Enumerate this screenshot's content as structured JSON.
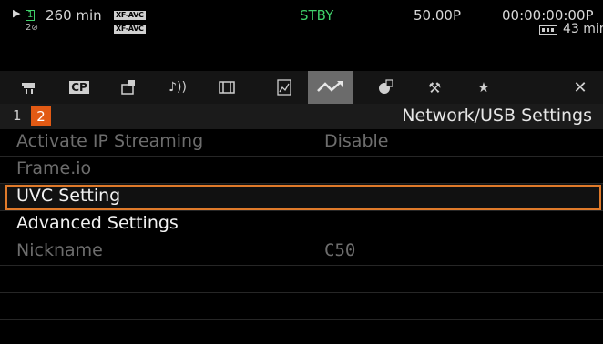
{
  "status": {
    "slot1_number": "1",
    "remaining": "260 min",
    "codec_top": "XF-AVC",
    "codec_bottom": "XF-AVC",
    "slot2_label": "2",
    "mode": "STBY",
    "frame_rate": "50.00P",
    "timecode": "00:00:00:00",
    "timecode_suffix": "P",
    "battery": "43 min"
  },
  "tabs": [
    {
      "icon": "camera-icon"
    },
    {
      "icon": "cp-icon",
      "label": "CP"
    },
    {
      "icon": "custom-picture-icon"
    },
    {
      "icon": "audio-icon"
    },
    {
      "icon": "recording-media-icon"
    },
    {
      "icon": "assist-functions-icon"
    },
    {
      "icon": "network-icon",
      "active": true
    },
    {
      "icon": "monitoring-icon"
    },
    {
      "icon": "system-setup-icon"
    },
    {
      "icon": "my-menu-star-icon"
    },
    {
      "icon": "close-icon"
    }
  ],
  "page": {
    "prev": "1",
    "current": "2",
    "title": "Network/USB Settings"
  },
  "menu": [
    {
      "label": "Activate IP Streaming",
      "value": "Disable",
      "state": "disabled"
    },
    {
      "label": "Frame.io",
      "value": "",
      "state": "disabled"
    },
    {
      "label": "UVC Setting",
      "value": "",
      "state": "selected"
    },
    {
      "label": "Advanced Settings",
      "value": "",
      "state": "enabled"
    },
    {
      "label": "Nickname",
      "value": "C50",
      "state": "disabled"
    }
  ],
  "colors": {
    "accent": "#e25a14",
    "select_border": "#e07a2a",
    "standby": "#3fd06a"
  }
}
